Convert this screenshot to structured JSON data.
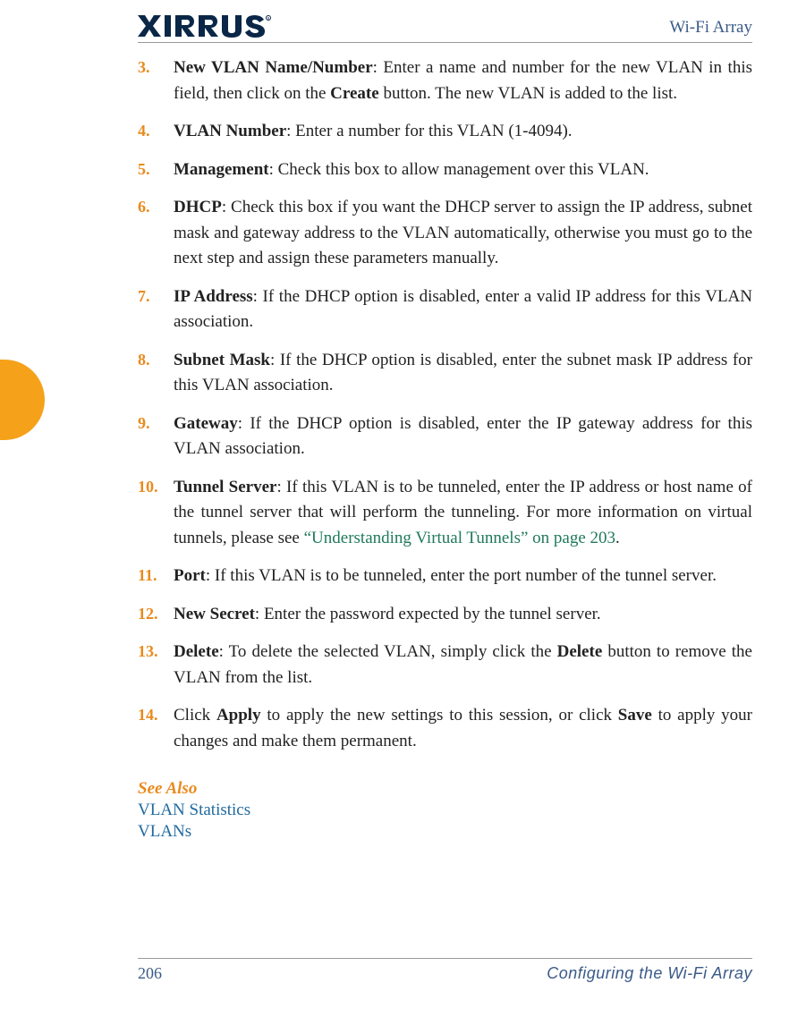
{
  "logo_text": "XIRRUS",
  "header": {
    "title": "Wi-Fi Array"
  },
  "steps": [
    {
      "num": "3.",
      "title": "New VLAN Name/Number",
      "body_before": ": Enter a name and number for the new VLAN in this field, then click on the ",
      "bold_inline": "Create",
      "body_after": " button. The new VLAN is added to the list."
    },
    {
      "num": "4.",
      "title": "VLAN Number",
      "body_before": ": Enter a number for this VLAN (1-4094).",
      "bold_inline": "",
      "body_after": ""
    },
    {
      "num": "5.",
      "title": "Management",
      "body_before": ": Check this box to allow management over this VLAN.",
      "bold_inline": "",
      "body_after": ""
    },
    {
      "num": "6.",
      "title": "DHCP",
      "body_before": ": Check this box if you want the DHCP server to assign the IP address, subnet mask and gateway address to the VLAN automatically, otherwise you must go to the next step and assign these parameters manually.",
      "bold_inline": "",
      "body_after": ""
    },
    {
      "num": "7.",
      "title": "IP Address",
      "body_before": ": If the DHCP option is disabled, enter a valid IP address for this VLAN association.",
      "bold_inline": "",
      "body_after": ""
    },
    {
      "num": "8.",
      "title": "Subnet Mask",
      "body_before": ": If the DHCP option is disabled, enter the subnet mask IP address for this VLAN association.",
      "bold_inline": "",
      "body_after": ""
    },
    {
      "num": "9.",
      "title": "Gateway",
      "body_before": ": If the DHCP option is disabled, enter the IP gateway address for this VLAN association.",
      "bold_inline": "",
      "body_after": ""
    },
    {
      "num": "10.",
      "title": "Tunnel Server",
      "body_before": ": If this VLAN is to be tunneled, enter the IP address or host name of the tunnel server that will perform the tunneling. For more information on virtual tunnels, please see ",
      "link_text": "“Understanding Virtual Tunnels” on page 203",
      "body_after": "."
    },
    {
      "num": "11.",
      "title": "Port",
      "body_before": ": If this VLAN is to be tunneled, enter the port number of the tunnel server.",
      "bold_inline": "",
      "body_after": ""
    },
    {
      "num": "12.",
      "title": "New Secret",
      "body_before": ": Enter the password expected by the tunnel server.",
      "bold_inline": "",
      "body_after": ""
    },
    {
      "num": "13.",
      "title": "Delete",
      "body_before": ": To delete the selected VLAN, simply click the ",
      "bold_inline": "Delete",
      "body_after": " button to remove the VLAN from the list."
    },
    {
      "num": "14.",
      "title": "",
      "body_before": "Click ",
      "bold_inline": "Apply",
      "body_mid": " to apply the new settings to this session, or click ",
      "bold_inline2": "Save",
      "body_after": " to apply your changes and make them permanent."
    }
  ],
  "see_also": {
    "heading": "See Also",
    "links": [
      "VLAN Statistics",
      "VLANs"
    ]
  },
  "footer": {
    "page_number": "206",
    "chapter": "Configuring the Wi-Fi Array"
  }
}
